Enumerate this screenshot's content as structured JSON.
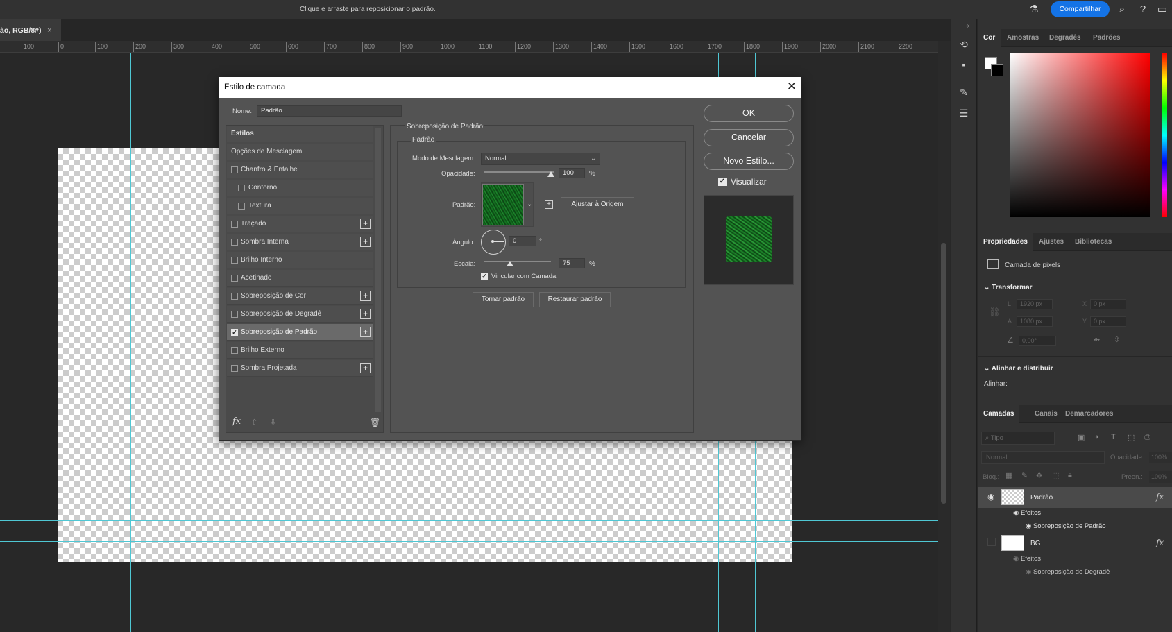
{
  "topbar": {
    "hint": "Clique e arraste para reposicionar o padrão.",
    "share_label": "Compartilhar"
  },
  "document": {
    "tab_label": "ão, RGB/8#)",
    "ruler_ticks": [
      "100",
      "0",
      "100",
      "200",
      "300",
      "400",
      "500",
      "600",
      "700",
      "800",
      "900",
      "1000",
      "1100",
      "1200",
      "1300",
      "1400",
      "1500",
      "1600",
      "1700",
      "1800",
      "1900",
      "2000",
      "2100",
      "2200"
    ]
  },
  "dialog": {
    "title": "Estilo de camada",
    "name_label": "Nome:",
    "name_value": "Padrão",
    "styles_header": "Estilos",
    "blend_options": "Opções de Mesclagem",
    "items": [
      {
        "label": "Chanfro & Entalhe",
        "checked": false,
        "plus": false
      },
      {
        "label": "Contorno",
        "checked": false,
        "plus": false
      },
      {
        "label": "Textura",
        "checked": false,
        "plus": false
      },
      {
        "label": "Traçado",
        "checked": false,
        "plus": true
      },
      {
        "label": "Sombra Interna",
        "checked": false,
        "plus": true
      },
      {
        "label": "Brilho Interno",
        "checked": false,
        "plus": false
      },
      {
        "label": "Acetinado",
        "checked": false,
        "plus": false
      },
      {
        "label": "Sobreposição de Cor",
        "checked": false,
        "plus": true
      },
      {
        "label": "Sobreposição de Degradê",
        "checked": false,
        "plus": true
      },
      {
        "label": "Sobreposição de Padrão",
        "checked": true,
        "plus": true
      },
      {
        "label": "Brilho Externo",
        "checked": false,
        "plus": false
      },
      {
        "label": "Sombra Projetada",
        "checked": false,
        "plus": true
      }
    ],
    "section_title": "Sobreposição de Padrão",
    "group_title": "Padrão",
    "blend_mode_label": "Modo de Mesclagem:",
    "blend_mode_value": "Normal",
    "opacity_label": "Opacidade:",
    "opacity_value": "100",
    "opacity_unit": "%",
    "pattern_label": "Padrão:",
    "snap_origin": "Ajustar à Origem",
    "angle_label": "Ângulo:",
    "angle_value": "0",
    "angle_unit": "°",
    "scale_label": "Escala:",
    "scale_value": "75",
    "scale_unit": "%",
    "link_label": "Vincular com Camada",
    "make_default": "Tornar padrão",
    "reset_default": "Restaurar padrão",
    "ok": "OK",
    "cancel": "Cancelar",
    "new_style": "Novo Estilo...",
    "preview_label": "Visualizar"
  },
  "color_panel": {
    "tabs": [
      "Cor",
      "Amostras",
      "Degradês",
      "Padrões"
    ]
  },
  "properties_panel": {
    "tabs": [
      "Propriedades",
      "Ajustes",
      "Bibliotecas"
    ],
    "layer_type": "Camada de pixels",
    "transform_title": "Transformar",
    "w_label": "L",
    "w_value": "1920 px",
    "h_label": "A",
    "h_value": "1080 px",
    "x_label": "X",
    "x_value": "0 px",
    "y_label": "Y",
    "y_value": "0 px",
    "angle_value": "0,00°",
    "align_title": "Alinhar e distribuir",
    "align_label": "Alinhar:"
  },
  "layers_panel": {
    "tabs": [
      "Camadas",
      "Canais",
      "Demarcadores"
    ],
    "search_placeholder": "Tipo",
    "blend_mode": "Normal",
    "opacity_label": "Opacidade:",
    "opacity_value": "100%",
    "lock_label": "Bloq.:",
    "fill_label": "Preen.:",
    "fill_value": "100%",
    "layers": [
      {
        "name": "Padrão",
        "effects_label": "Efeitos",
        "effect": "Sobreposição de Padrão"
      },
      {
        "name": "BG",
        "effects_label": "Efeitos",
        "effect": "Sobreposição de Degradê"
      }
    ]
  }
}
